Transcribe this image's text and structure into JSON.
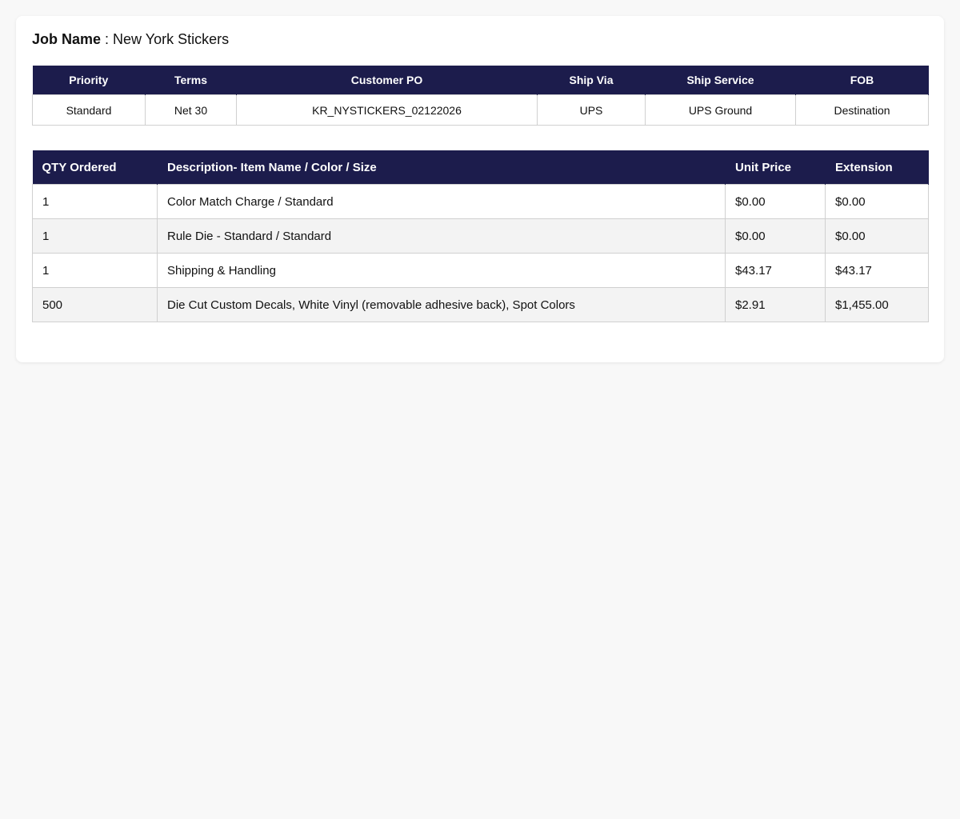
{
  "job": {
    "label": "Job Name",
    "separator": " : ",
    "value": "New York Stickers"
  },
  "order_info": {
    "headers": [
      "Priority",
      "Terms",
      "Customer PO",
      "Ship Via",
      "Ship Service",
      "FOB"
    ],
    "values": [
      "Standard",
      "Net 30",
      "KR_NYSTICKERS_02122026",
      "UPS",
      "UPS Ground",
      "Destination"
    ]
  },
  "line_items": {
    "headers": [
      "QTY Ordered",
      "Description- Item Name / Color / Size",
      "Unit Price",
      "Extension"
    ],
    "rows": [
      {
        "qty": "1",
        "description": "Color Match Charge / Standard",
        "unit_price": "$0.00",
        "extension": "$0.00"
      },
      {
        "qty": "1",
        "description": "Rule Die - Standard / Standard",
        "unit_price": "$0.00",
        "extension": "$0.00"
      },
      {
        "qty": "1",
        "description": "Shipping & Handling",
        "unit_price": "$43.17",
        "extension": "$43.17"
      },
      {
        "qty": "500",
        "description": "Die Cut Custom Decals, White Vinyl (removable adhesive back), Spot Colors",
        "unit_price": "$2.91",
        "extension": "$1,455.00"
      }
    ]
  },
  "colors": {
    "header_bg": "#1c1c4c",
    "header_text": "#ffffff",
    "row_alt": "#f3f3f3",
    "border": "#d0d0d0",
    "page_bg": "#f8f8f8"
  }
}
